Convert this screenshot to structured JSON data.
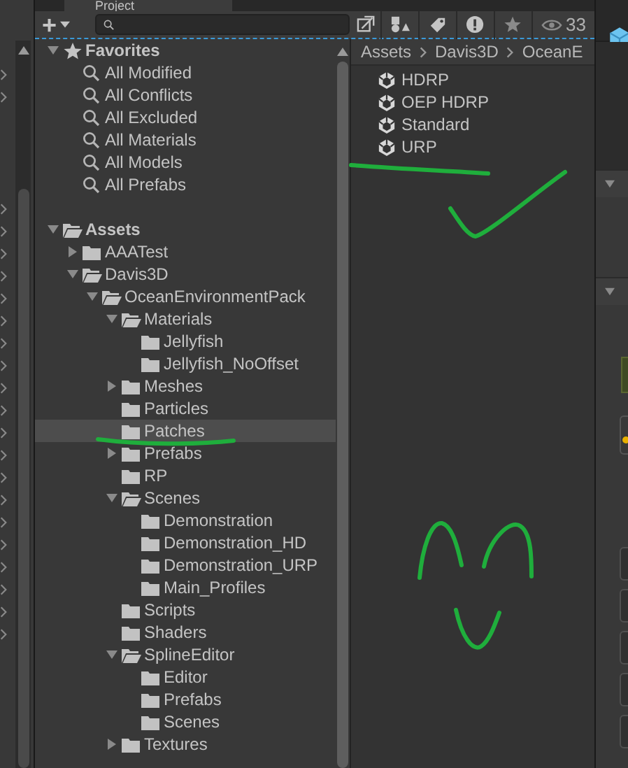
{
  "panel_tab": {
    "title": "Project"
  },
  "toolbar": {
    "add_label": "+",
    "hidden_count": "33"
  },
  "favorites": {
    "label": "Favorites",
    "expanded": true,
    "items": [
      "All Modified",
      "All Conflicts",
      "All Excluded",
      "All Materials",
      "All Models",
      "All Prefabs"
    ]
  },
  "assets_tree": [
    {
      "label": "Assets",
      "expanded": true,
      "selected": false,
      "children": [
        {
          "label": "AAATest",
          "expanded": false,
          "selected": false
        },
        {
          "label": "Davis3D",
          "expanded": true,
          "selected": false,
          "children": [
            {
              "label": "OceanEnvironmentPack",
              "expanded": true,
              "selected": false,
              "children": [
                {
                  "label": "Materials",
                  "expanded": true,
                  "selected": false,
                  "children": [
                    {
                      "label": "Jellyfish",
                      "selected": false
                    },
                    {
                      "label": "Jellyfish_NoOffset",
                      "selected": false
                    }
                  ]
                },
                {
                  "label": "Meshes",
                  "expanded": false,
                  "selected": false
                },
                {
                  "label": "Particles",
                  "selected": false
                },
                {
                  "label": "Patches",
                  "selected": true
                },
                {
                  "label": "Prefabs",
                  "expanded": false,
                  "selected": false
                },
                {
                  "label": "RP",
                  "selected": false
                },
                {
                  "label": "Scenes",
                  "expanded": true,
                  "selected": false,
                  "children": [
                    {
                      "label": "Demonstration",
                      "selected": false
                    },
                    {
                      "label": "Demonstration_HD",
                      "selected": false
                    },
                    {
                      "label": "Demonstration_URP",
                      "selected": false
                    },
                    {
                      "label": "Main_Profiles",
                      "selected": false
                    }
                  ]
                },
                {
                  "label": "Scripts",
                  "selected": false
                },
                {
                  "label": "Shaders",
                  "selected": false
                },
                {
                  "label": "SplineEditor",
                  "expanded": true,
                  "selected": false,
                  "children": [
                    {
                      "label": "Editor",
                      "selected": false
                    },
                    {
                      "label": "Prefabs",
                      "selected": false
                    },
                    {
                      "label": "Scenes",
                      "selected": false
                    }
                  ]
                },
                {
                  "label": "Textures",
                  "expanded": false,
                  "selected": false
                }
              ]
            }
          ]
        }
      ]
    }
  ],
  "breadcrumb": [
    "Assets",
    "Davis3D",
    "OceanE"
  ],
  "files": [
    "HDRP",
    "OEP HDRP",
    "Standard",
    "URP"
  ],
  "inspector": {
    "sections": [
      {
        "expanded": true
      },
      {
        "expanded": true
      }
    ]
  }
}
